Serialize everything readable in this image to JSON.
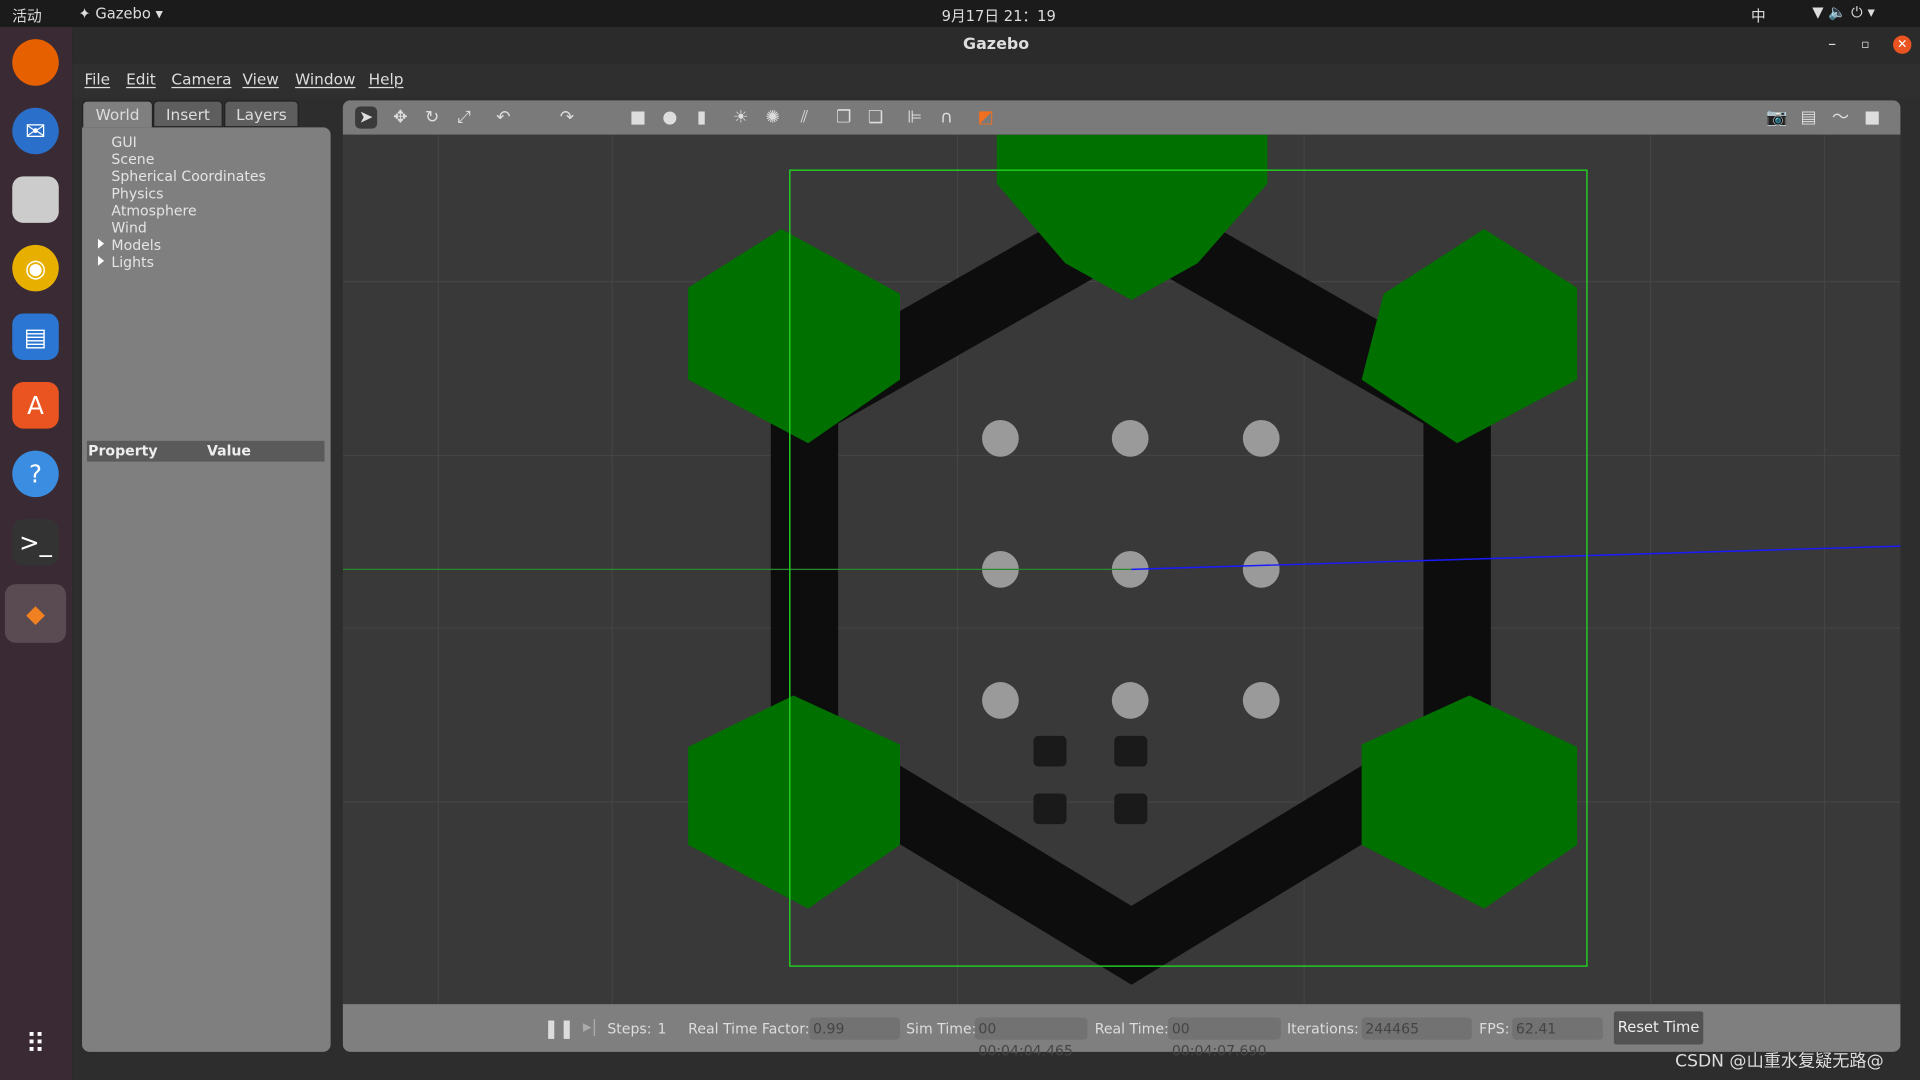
{
  "topbar": {
    "activities": "活动",
    "app_menu": "Gazebo",
    "clock": "9月17日 21：19",
    "input_method": "中"
  },
  "window": {
    "title": "Gazebo"
  },
  "menu": [
    "File",
    "Edit",
    "Camera",
    "View",
    "Window",
    "Help"
  ],
  "left_panel": {
    "tabs": [
      "World",
      "Insert",
      "Layers"
    ],
    "active_tab": "World",
    "tree": [
      "GUI",
      "Scene",
      "Spherical Coordinates",
      "Physics",
      "Atmosphere",
      "Wind",
      "Models",
      "Lights"
    ],
    "property_header": "Property",
    "value_header": "Value"
  },
  "status": {
    "steps_label": "Steps:",
    "steps_value": "1",
    "rtf_label": "Real Time Factor:",
    "rtf_value": "0.99",
    "sim_time_label": "Sim Time:",
    "sim_time": "00 00:04:04.465",
    "real_time_label": "Real Time:",
    "real_time": "00 00:04:07.690",
    "iterations_label": "Iterations:",
    "iterations": "244465",
    "fps_label": "FPS:",
    "fps": "62.41",
    "reset_label": "Reset Time"
  },
  "watermark": "CSDN @山重水复疑无路@",
  "colors": {
    "ground": "#393939",
    "wall": "#0d0d0d",
    "hex_block": "#007000",
    "bbox": "#22cc22",
    "close": "#e95420"
  }
}
